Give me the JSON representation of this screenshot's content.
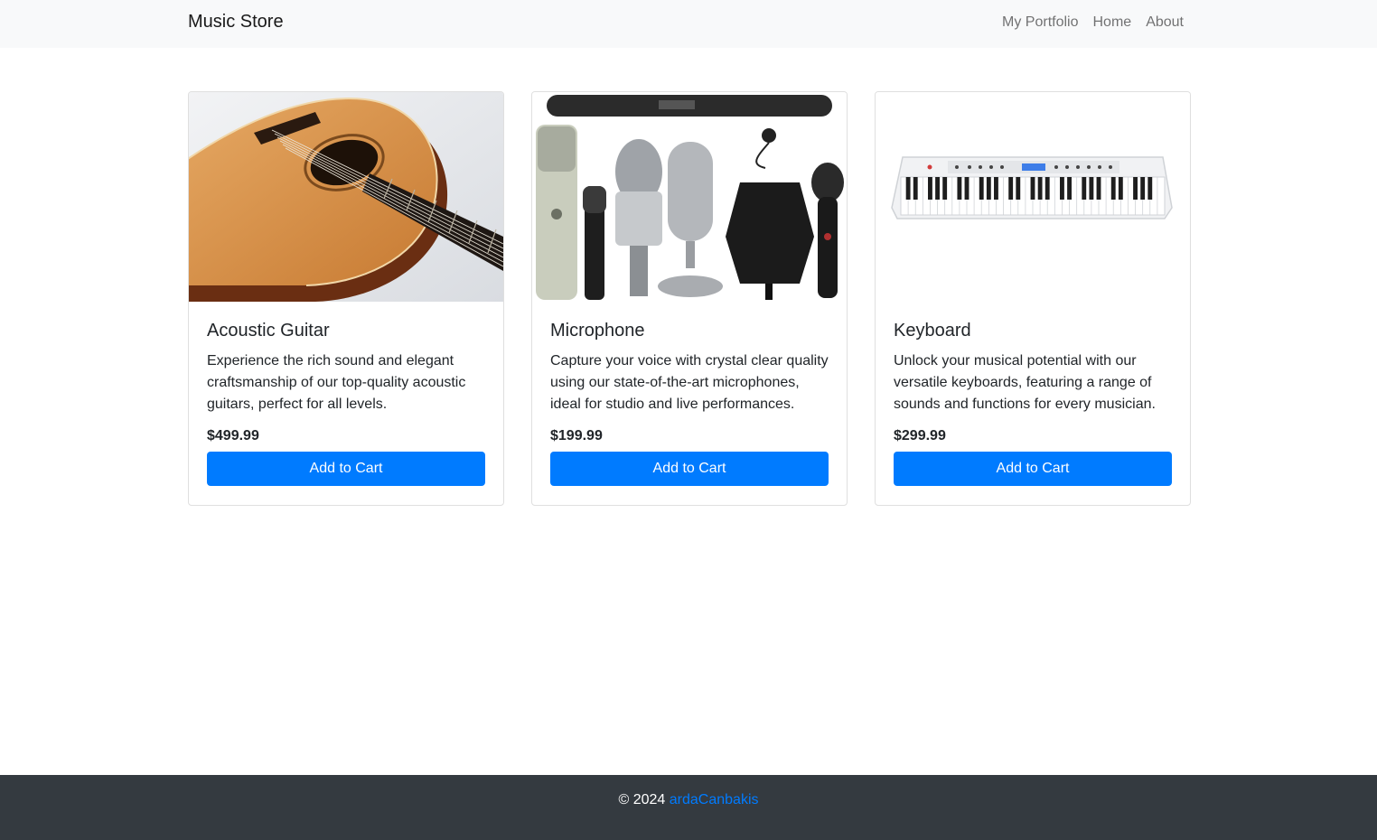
{
  "navbar": {
    "brand": "Music Store",
    "links": [
      "My Portfolio",
      "Home",
      "About"
    ]
  },
  "products": [
    {
      "image_icon": "acoustic-guitar-image",
      "title": "Acoustic Guitar",
      "description": "Experience the rich sound and elegant craftsmanship of our top-quality acoustic guitars, perfect for all levels.",
      "price": "$499.99",
      "button": "Add to Cart"
    },
    {
      "image_icon": "microphones-image",
      "title": "Microphone",
      "description": "Capture your voice with crystal clear quality using our state-of-the-art microphones, ideal for studio and live performances.",
      "price": "$199.99",
      "button": "Add to Cart"
    },
    {
      "image_icon": "keyboard-image",
      "title": "Keyboard",
      "description": "Unlock your musical potential with our versatile keyboards, featuring a range of sounds and functions for every musician.",
      "price": "$299.99",
      "button": "Add to Cart"
    }
  ],
  "footer": {
    "copyright": "© 2024",
    "author_link": "ardaCanbakis"
  },
  "colors": {
    "primary": "#007bff",
    "navbar_bg": "#f8f9fa",
    "footer_bg": "#343a40"
  }
}
